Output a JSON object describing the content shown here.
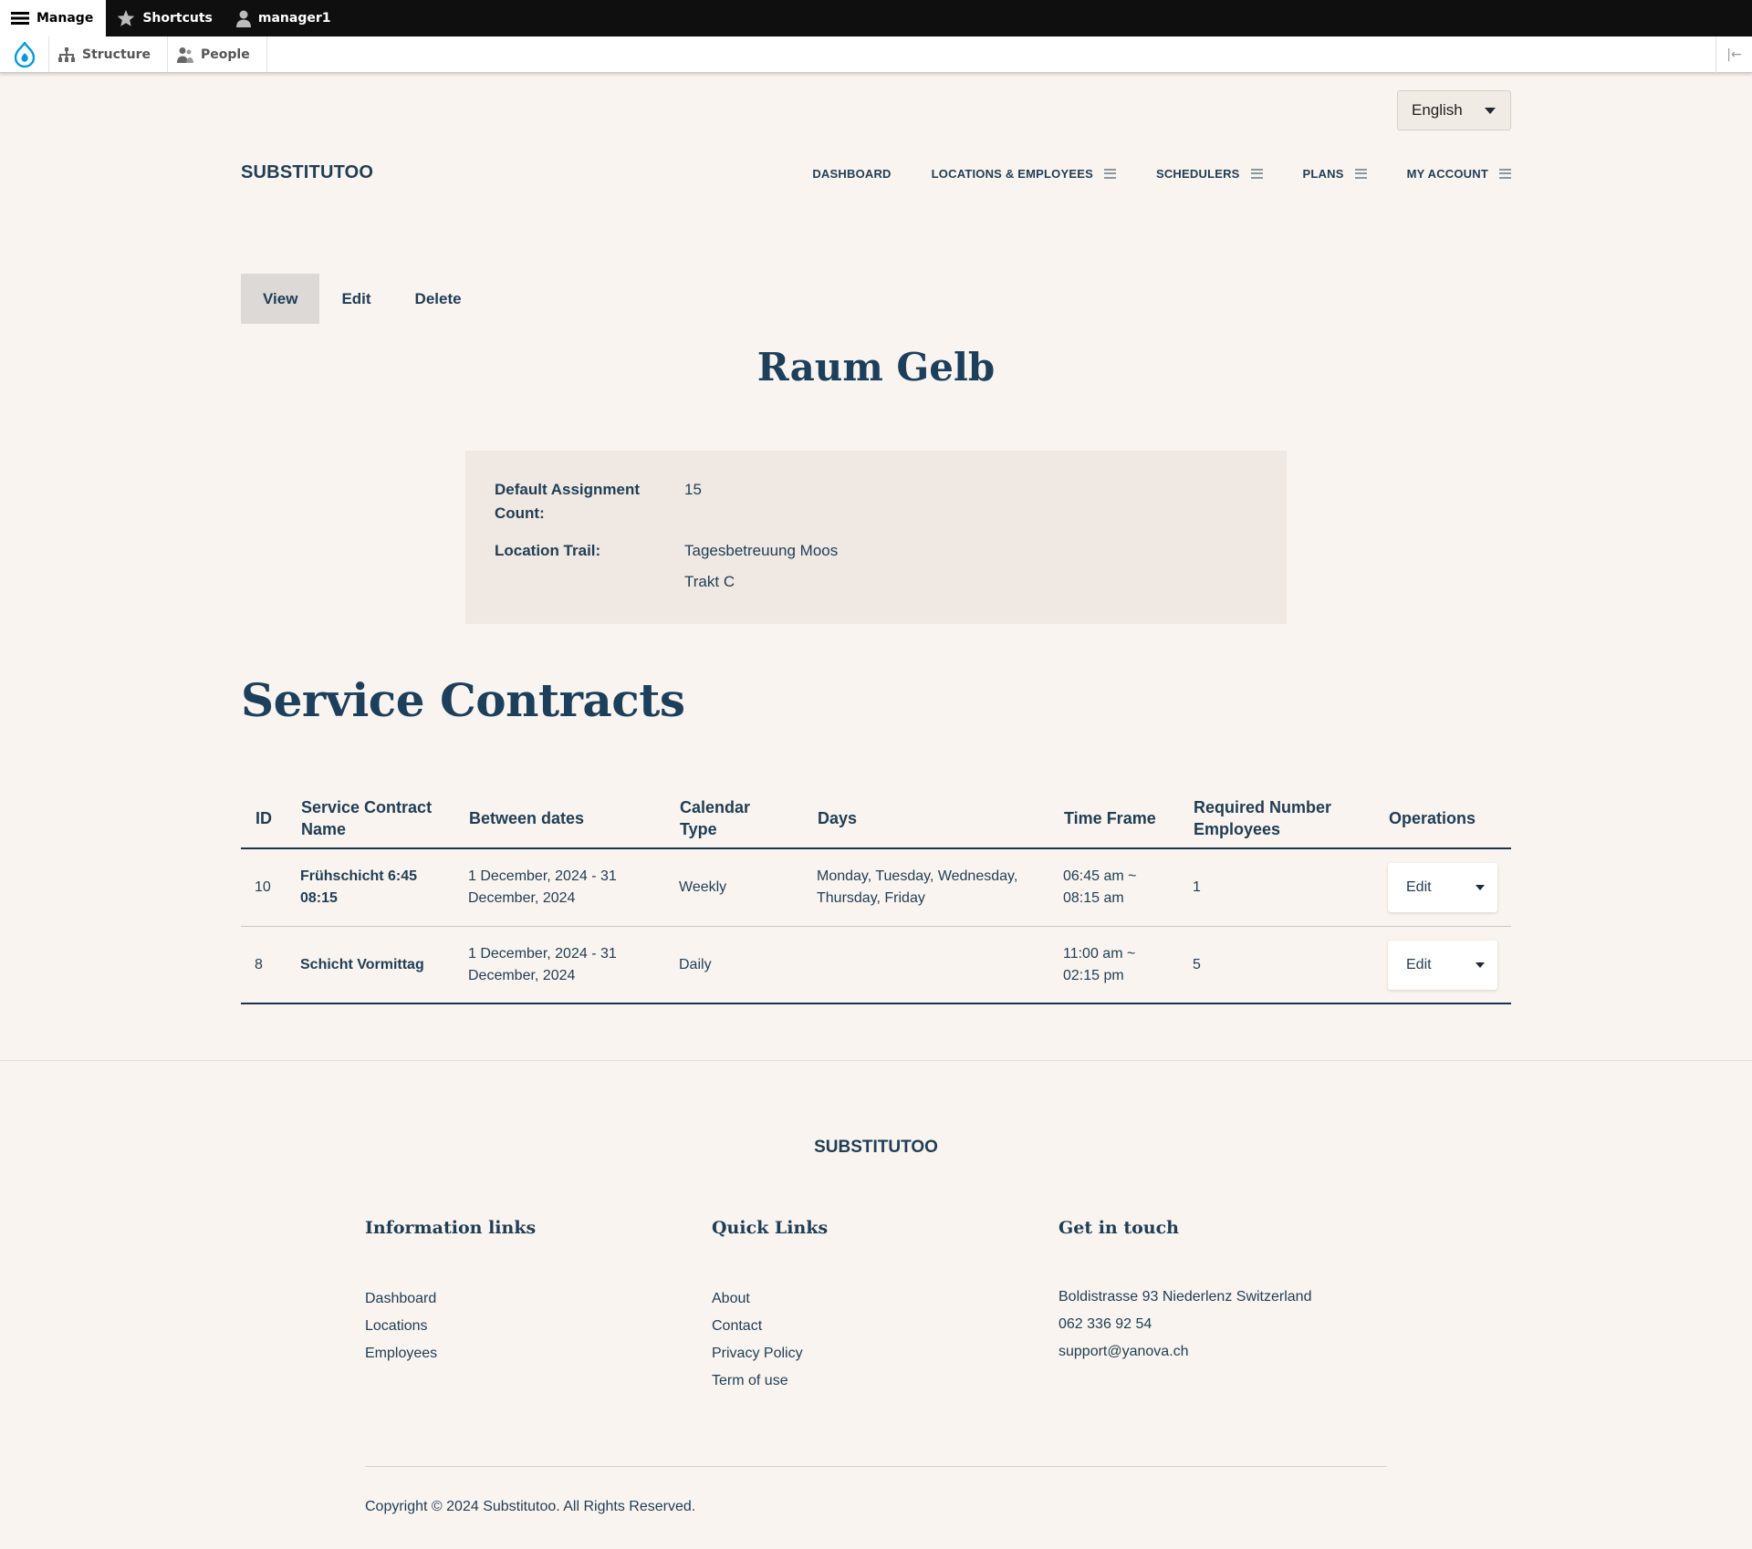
{
  "toolbar": {
    "manage": "Manage",
    "shortcuts": "Shortcuts",
    "user": "manager1",
    "structure": "Structure",
    "people": "People"
  },
  "language": {
    "selected": "English"
  },
  "site": {
    "name": "SUBSTITUTOO"
  },
  "nav": {
    "items": [
      {
        "label": "DASHBOARD",
        "menu": false
      },
      {
        "label": "LOCATIONS & EMPLOYEES",
        "menu": true
      },
      {
        "label": "SCHEDULERS",
        "menu": true
      },
      {
        "label": "PLANS",
        "menu": true
      },
      {
        "label": "MY ACCOUNT",
        "menu": true
      }
    ]
  },
  "tabs": [
    "View",
    "Edit",
    "Delete"
  ],
  "page": {
    "title": "Raum Gelb"
  },
  "details": {
    "default_assignment_label": "Default Assignment Count:",
    "default_assignment_value": "15",
    "location_trail_label": "Location Trail:",
    "location_trail": [
      "Tagesbetreuung Moos",
      "Trakt C"
    ]
  },
  "contracts": {
    "title": "Service Contracts",
    "headers": [
      "ID",
      "Service Contract Name",
      "Between dates",
      "Calendar Type",
      "Days",
      "Time Frame",
      "Required Number Employees",
      "Operations"
    ],
    "rows": [
      {
        "id": "10",
        "name": "Frühschicht 6:45 08:15",
        "dates": "1 December, 2024 - 31 December, 2024",
        "calendar": "Weekly",
        "days": "Monday, Tuesday, Wednesday, Thursday, Friday",
        "time": "06:45 am ~ 08:15 am",
        "required": "1",
        "op": "Edit"
      },
      {
        "id": "8",
        "name": "Schicht Vormittag",
        "dates": "1 December, 2024 - 31 December, 2024",
        "calendar": "Daily",
        "days": "",
        "time": "11:00 am ~ 02:15 pm",
        "required": "5",
        "op": "Edit"
      }
    ]
  },
  "footer": {
    "name": "SUBSTITUTOO",
    "info_title": "Information links",
    "info_links": [
      "Dashboard",
      "Locations",
      "Employees"
    ],
    "quick_title": "Quick Links",
    "quick_links": [
      "About",
      "Contact",
      "Privacy Policy",
      "Term of use"
    ],
    "contact_title": "Get in touch",
    "contact": [
      "Boldistrasse 93 Niederlenz Switzerland",
      "062 336 92 54",
      "support@yanova.ch"
    ],
    "copyright": "Copyright © 2024 Substitutoo. All Rights Reserved."
  },
  "colors": {
    "background": "#f9f4ef",
    "primary": "#1f3d55",
    "toolbar": "#0f0f0f",
    "drupal_blue": "#009cde"
  }
}
